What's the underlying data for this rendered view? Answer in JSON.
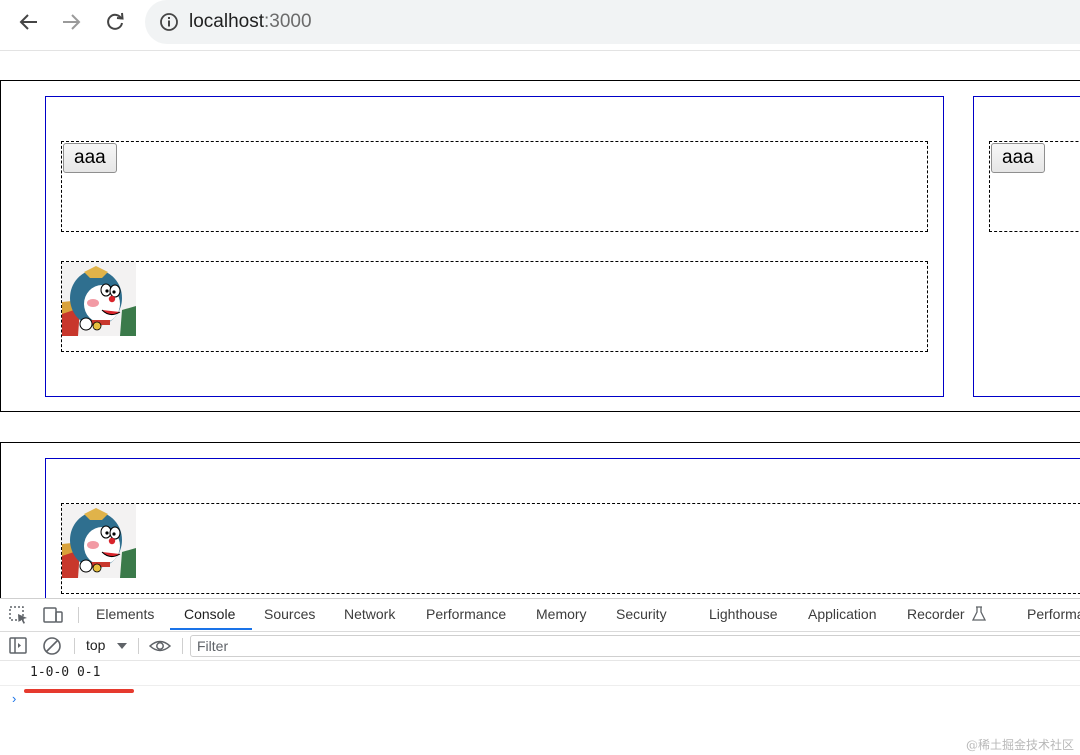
{
  "browser": {
    "url_host": "localhost",
    "url_port": ":3000"
  },
  "page": {
    "sections": [
      {
        "card_button_label": "aaa",
        "card2_button_label": "aaa"
      }
    ]
  },
  "devtools": {
    "tabs": [
      "Elements",
      "Console",
      "Sources",
      "Network",
      "Performance",
      "Memory",
      "Security",
      "Lighthouse",
      "Application",
      "Recorder",
      "Performa"
    ],
    "active_tab": "Console",
    "context": "top",
    "filter_placeholder": "Filter",
    "log_line": "1-0-0 0-1",
    "prompt_symbol": "›"
  },
  "watermark": "@稀土掘金技术社区",
  "colors": {
    "card_border": "#0000c8",
    "active_tab_underline": "#1a73e8",
    "annotation_red": "#e63a2e"
  },
  "icons": [
    "back-arrow-icon",
    "forward-arrow-icon",
    "reload-icon",
    "info-icon",
    "inspect-element-icon",
    "device-toolbar-icon",
    "sidebar-toggle-icon",
    "clear-console-icon",
    "eye-icon",
    "flask-icon"
  ]
}
